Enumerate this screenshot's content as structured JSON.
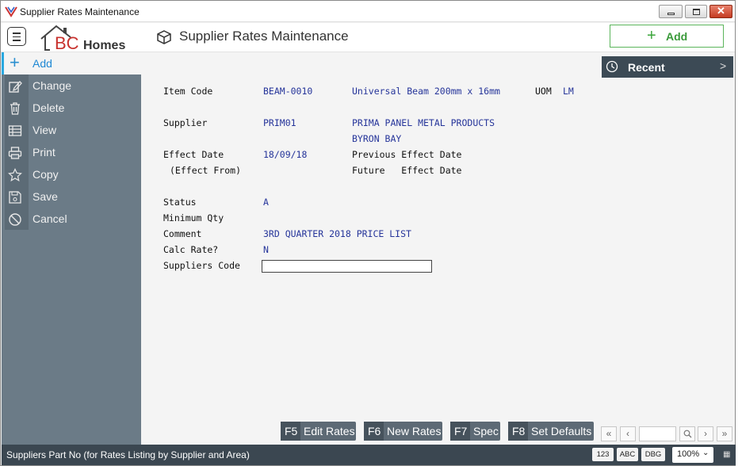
{
  "window": {
    "title": "Supplier Rates Maintenance"
  },
  "header": {
    "logo_text_bc": "BC",
    "logo_text_homes": "Homes",
    "page_title": "Supplier Rates Maintenance",
    "add_label": "Add"
  },
  "sidebar": {
    "add_label": "Add",
    "items": [
      {
        "label": "Change",
        "icon": "edit-icon"
      },
      {
        "label": "Delete",
        "icon": "trash-icon"
      },
      {
        "label": "View",
        "icon": "table-icon"
      },
      {
        "label": "Print",
        "icon": "printer-icon"
      },
      {
        "label": "Copy",
        "icon": "star-icon"
      },
      {
        "label": "Save",
        "icon": "save-icon"
      },
      {
        "label": "Cancel",
        "icon": "cancel-icon"
      }
    ]
  },
  "recent": {
    "label": "Recent"
  },
  "form": {
    "item_code_label": "Item Code",
    "item_code_value": "BEAM-0010",
    "item_desc_value": "Universal Beam 200mm x 16mm",
    "uom_label": "UOM",
    "uom_value": "LM",
    "supplier_label": "Supplier",
    "supplier_value": "PRIM01",
    "supplier_name": "PRIMA PANEL METAL PRODUCTS",
    "supplier_location": "BYRON BAY",
    "effect_date_label": "Effect Date",
    "effect_date_value": "18/09/18",
    "effect_from_label": "(Effect From)",
    "previous_effect_label": "Previous Effect Date",
    "future_effect_label": "Future   Effect Date",
    "status_label": "Status",
    "status_value": "A",
    "min_qty_label": "Minimum Qty",
    "comment_label": "Comment",
    "comment_value": "3RD QUARTER 2018 PRICE LIST",
    "calc_rate_label": "Calc Rate?",
    "calc_rate_value": "N",
    "suppliers_code_label": "Suppliers Code",
    "suppliers_code_value": ""
  },
  "function_keys": [
    {
      "key": "F5",
      "label": "Edit Rates"
    },
    {
      "key": "F6",
      "label": "New Rates"
    },
    {
      "key": "F7",
      "label": "Spec"
    },
    {
      "key": "F8",
      "label": "Set Defaults"
    }
  ],
  "pager": {
    "first": "«",
    "prev": "‹",
    "next": "›",
    "last": "»",
    "page_value": ""
  },
  "statusbar": {
    "text": "Suppliers Part No (for Rates Listing by Supplier and Area)",
    "badge_123": "123",
    "badge_abc": "ABC",
    "badge_dbg": "DBG",
    "zoom": "100%"
  },
  "colors": {
    "accent": "#29a8e0",
    "sidebar": "#6b7b87",
    "statusbar": "#3b4751",
    "add_green": "#3a9a3a",
    "value_blue": "#26359a"
  }
}
